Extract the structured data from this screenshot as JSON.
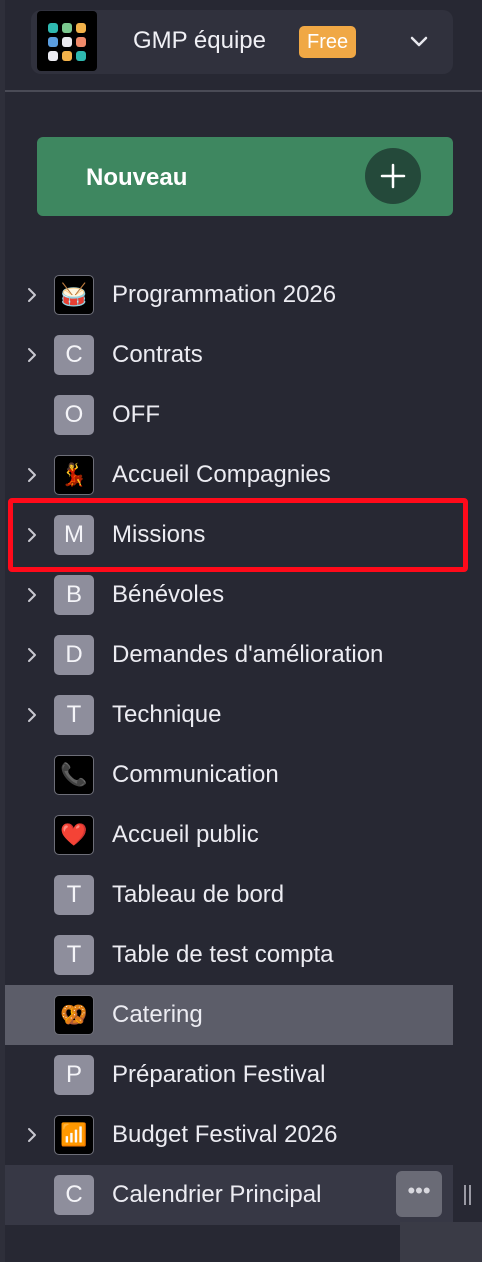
{
  "workspace": {
    "name": "GMP équipe",
    "plan_badge": "Free"
  },
  "new_button": {
    "label": "Nouveau"
  },
  "tables": [
    {
      "label": "Programmation 2026",
      "icon": "🥁",
      "icon_type": "emoji",
      "expandable": true
    },
    {
      "label": "Contrats",
      "icon": "C",
      "icon_type": "letter",
      "expandable": true
    },
    {
      "label": "OFF",
      "icon": "O",
      "icon_type": "letter",
      "expandable": false
    },
    {
      "label": "Accueil Compagnies",
      "icon": "💃",
      "icon_type": "emoji",
      "expandable": true
    },
    {
      "label": "Missions",
      "icon": "M",
      "icon_type": "letter",
      "expandable": true,
      "highlighted": true
    },
    {
      "label": "Bénévoles",
      "icon": "B",
      "icon_type": "letter",
      "expandable": true
    },
    {
      "label": "Demandes d'amélioration",
      "icon": "D",
      "icon_type": "letter",
      "expandable": true
    },
    {
      "label": "Technique",
      "icon": "T",
      "icon_type": "letter",
      "expandable": true
    },
    {
      "label": "Communication",
      "icon": "📞",
      "icon_type": "emoji",
      "expandable": false
    },
    {
      "label": "Accueil public",
      "icon": "❤️",
      "icon_type": "emoji",
      "expandable": false
    },
    {
      "label": "Tableau de bord",
      "icon": "T",
      "icon_type": "letter",
      "expandable": false
    },
    {
      "label": "Table de test compta",
      "icon": "T",
      "icon_type": "letter",
      "expandable": false
    },
    {
      "label": "Catering",
      "icon": "🥨",
      "icon_type": "emoji",
      "expandable": false,
      "selected": true
    },
    {
      "label": "Préparation Festival",
      "icon": "P",
      "icon_type": "letter",
      "expandable": false
    },
    {
      "label": "Budget Festival 2026",
      "icon": "📶",
      "icon_type": "emoji",
      "expandable": true
    },
    {
      "label": "Calendrier Principal",
      "icon": "C",
      "icon_type": "letter",
      "expandable": false,
      "hovered": true,
      "more_button": "•••"
    }
  ],
  "colors": {
    "background": "#272833",
    "accent_green": "#3e8760",
    "badge_orange": "#f0a845",
    "highlight_red": "#ff0a1a",
    "selected_row": "#5c5d69"
  }
}
